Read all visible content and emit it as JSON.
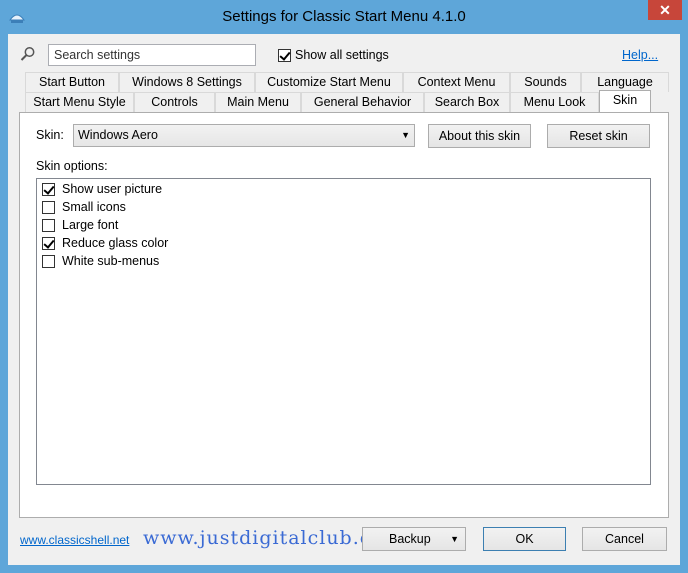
{
  "window": {
    "title": "Settings for Classic Start Menu 4.1.0",
    "close": "✕"
  },
  "search": {
    "placeholder": "Search settings",
    "value": ""
  },
  "show_all": {
    "label": "Show all settings",
    "checked": true
  },
  "help_link": "Help...",
  "tabs_row1": [
    "Start Button",
    "Windows 8 Settings",
    "Customize Start Menu",
    "Context Menu",
    "Sounds",
    "Language"
  ],
  "tabs_row2": [
    "Start Menu Style",
    "Controls",
    "Main Menu",
    "General Behavior",
    "Search Box",
    "Menu Look",
    "Skin"
  ],
  "active_tab": "Skin",
  "skin": {
    "label": "Skin:",
    "selected": "Windows Aero",
    "about_button": "About this skin",
    "reset_button": "Reset skin"
  },
  "skin_options": {
    "label": "Skin options:",
    "items": [
      {
        "label": "Show user picture",
        "checked": true
      },
      {
        "label": "Small icons",
        "checked": false
      },
      {
        "label": "Large font",
        "checked": false
      },
      {
        "label": "Reduce glass color",
        "checked": true
      },
      {
        "label": "White sub-menus",
        "checked": false
      }
    ]
  },
  "footer": {
    "link": "www.classicshell.net",
    "watermark": "www.justdigitalclub.com",
    "backup_button": "Backup",
    "ok_button": "OK",
    "cancel_button": "Cancel"
  }
}
